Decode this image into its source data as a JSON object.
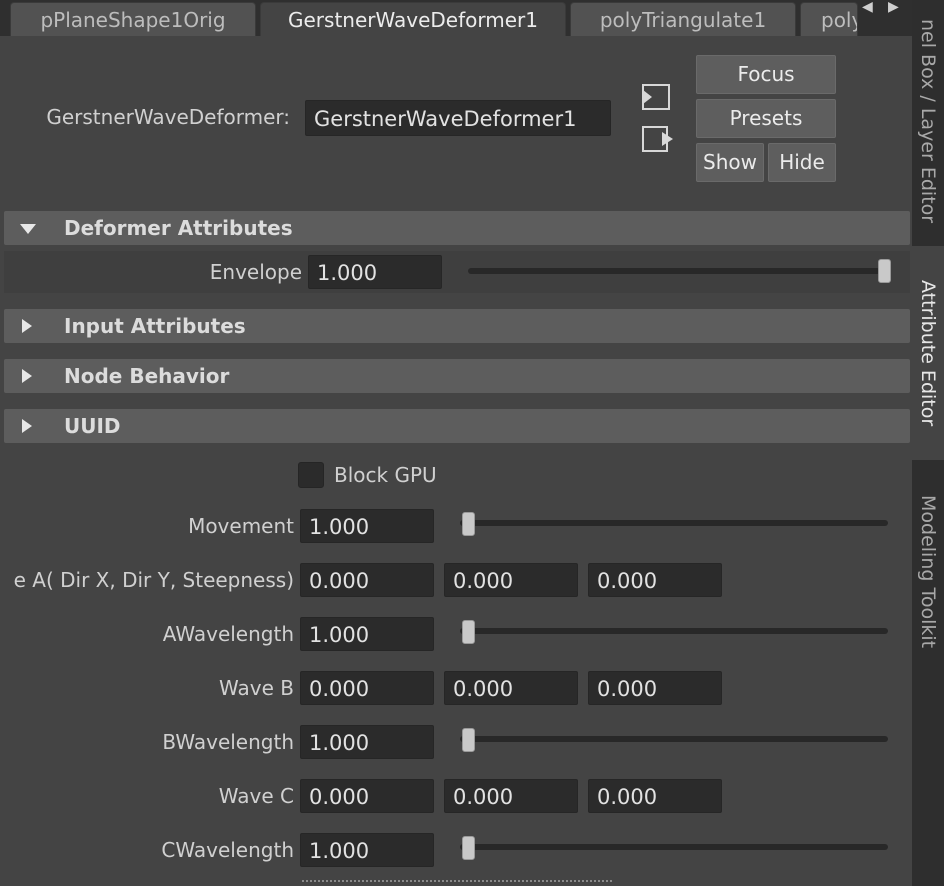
{
  "tabs": [
    {
      "label": "pPlaneShape1Orig",
      "active": false
    },
    {
      "label": "GerstnerWaveDeformer1",
      "active": true
    },
    {
      "label": "polyTriangulate1",
      "active": false
    },
    {
      "label": "poly",
      "active": false
    }
  ],
  "side_tabs": [
    {
      "label": "nel Box / Layer Editor",
      "active": false
    },
    {
      "label": "Attribute Editor",
      "active": true
    },
    {
      "label": "Modeling Toolkit",
      "active": false
    }
  ],
  "header": {
    "node_type_label": "GerstnerWaveDeformer:",
    "node_name": "GerstnerWaveDeformer1",
    "focus_label": "Focus",
    "presets_label": "Presets",
    "show_label": "Show",
    "hide_label": "Hide"
  },
  "sections": {
    "deformer": {
      "title": "Deformer Attributes",
      "expanded": true
    },
    "input": {
      "title": "Input Attributes",
      "expanded": false
    },
    "node_behavior": {
      "title": "Node Behavior",
      "expanded": false
    },
    "uuid": {
      "title": "UUID",
      "expanded": false
    }
  },
  "envelope": {
    "label": "Envelope",
    "value": "1.000",
    "slider_fraction": 1.0
  },
  "block_gpu": {
    "label": "Block GPU",
    "checked": false
  },
  "attributes": {
    "movement": {
      "label": "Movement",
      "value": "1.000",
      "slider_fraction": 0.0
    },
    "wave_a": {
      "label": "e A( Dir X, Dir Y, Steepness)",
      "values": [
        "0.000",
        "0.000",
        "0.000"
      ]
    },
    "a_wavelength": {
      "label": "AWavelength",
      "value": "1.000",
      "slider_fraction": 0.0
    },
    "wave_b": {
      "label": "Wave B",
      "values": [
        "0.000",
        "0.000",
        "0.000"
      ]
    },
    "b_wavelength": {
      "label": "BWavelength",
      "value": "1.000",
      "slider_fraction": 0.0
    },
    "wave_c": {
      "label": "Wave C",
      "values": [
        "0.000",
        "0.000",
        "0.000"
      ]
    },
    "c_wavelength": {
      "label": "CWavelength",
      "value": "1.000",
      "slider_fraction": 0.0
    }
  },
  "icons": [
    "tab-scroll-left-icon",
    "tab-scroll-right-icon",
    "load-selected-icon",
    "copy-tab-icon",
    "expand-triangle-icon",
    "collapse-triangle-icon"
  ]
}
